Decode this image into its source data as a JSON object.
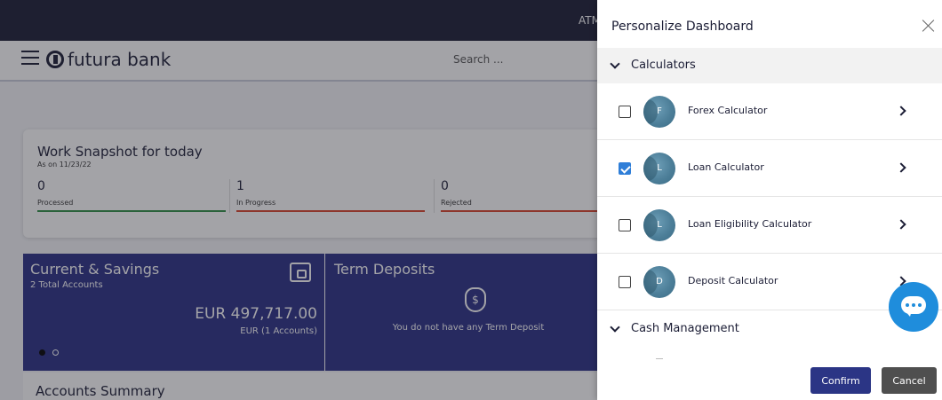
{
  "app": {
    "top_strip_text": "ATM",
    "brand": "futura bank",
    "search_placeholder": "Search ...",
    "snapshot": {
      "title": "Work Snapshot for today",
      "date": "As on 11/23/22",
      "metrics": [
        {
          "value": "0",
          "label": "Processed"
        },
        {
          "value": "1",
          "label": "In Progress"
        },
        {
          "value": "0",
          "label": "Rejected"
        }
      ]
    },
    "current_savings": {
      "title": "Current & Savings",
      "subtitle": "2 Total Accounts",
      "amount": "EUR 497,717.00",
      "amount_sub": "EUR (1 Accounts)"
    },
    "term_deposits": {
      "title": "Term Deposits",
      "message": "You do not have any Term Deposit"
    },
    "accounts_summary": "Accounts Summary"
  },
  "panel": {
    "title": "Personalize Dashboard",
    "sections": [
      {
        "label": "Calculators",
        "items": [
          {
            "initial": "F",
            "name": "Forex Calculator",
            "checked": false
          },
          {
            "initial": "L",
            "name": "Loan Calculator",
            "checked": true
          },
          {
            "initial": "L",
            "name": "Loan Eligibility Calculator",
            "checked": false
          },
          {
            "initial": "D",
            "name": "Deposit Calculator",
            "checked": false
          }
        ]
      },
      {
        "label": "Cash Management"
      }
    ],
    "confirm_label": "Confirm",
    "cancel_label": "Cancel"
  },
  "colors": {
    "brand_dark": "#1b1d35",
    "card_blue": "#2a2f86",
    "confirm_blue": "#2b3585",
    "cancel_grey": "#4f4f4f",
    "checkbox_blue": "#2f7ed8",
    "chat_blue": "#1f8ddc",
    "processed_green": "#2f8f46",
    "progress_red": "#d9442b"
  },
  "icons": {
    "menu": "hamburger-icon",
    "logo": "futura-logo-icon",
    "close": "close-icon",
    "section_toggle": "chevron-down-icon",
    "item_arrow": "chevron-right-icon",
    "chat": "chat-bubble-icon",
    "wallet": "wallet-icon",
    "money_bag": "money-bag-icon"
  }
}
